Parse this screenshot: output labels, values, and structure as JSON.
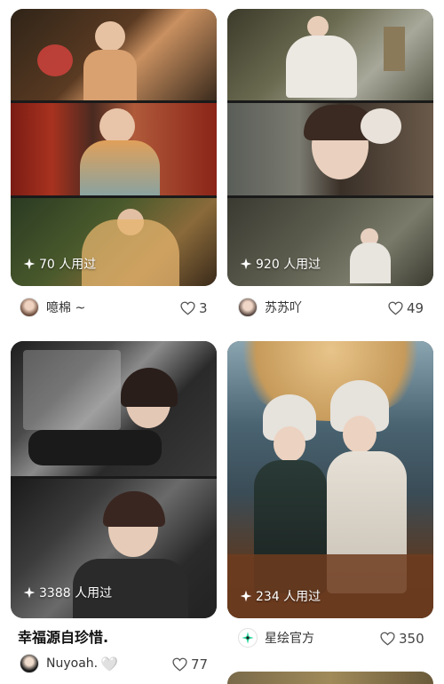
{
  "cards": [
    {
      "usage": "70 人用过",
      "username": "噫棉 ~",
      "likes": "3",
      "image_colors": [
        "#3b2a1e",
        "#8a2a1e",
        "#2e3a24"
      ]
    },
    {
      "usage": "920 人用过",
      "username": "苏苏吖",
      "likes": "49",
      "image_colors": [
        "#6a6a5c",
        "#6b5a4a",
        "#4c4a44"
      ]
    },
    {
      "usage": "3388 人用过",
      "title": "幸福源自珍惜.",
      "username": "Nuyoah.",
      "username_emoji": "🤍",
      "likes": "77",
      "image_colors": [
        "#3a3a3a",
        "#2c2c2c"
      ]
    },
    {
      "usage": "234 人用过",
      "username": "星绘官方",
      "likes": "350",
      "image_colors": [
        "#4f6a7a",
        "#2a2a2a"
      ]
    }
  ],
  "colors": {
    "page_background": "#ffffff",
    "brand_avatar": "#2fd6a0",
    "text": "#333333"
  },
  "icons": {
    "usage": "sparkle-icon",
    "likes": "heart-outline-icon"
  }
}
